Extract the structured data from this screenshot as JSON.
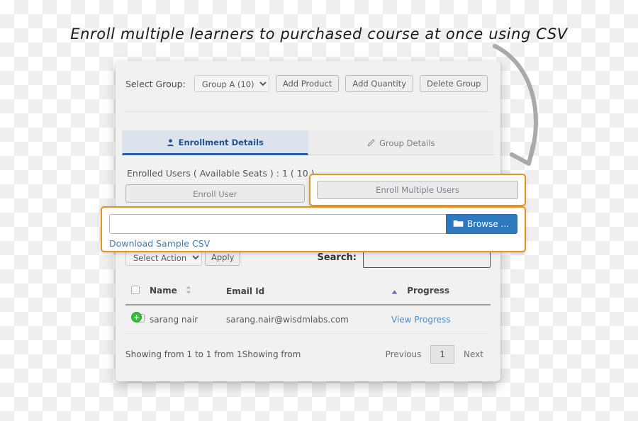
{
  "headline": "Enroll multiple learners to purchased course at once using CSV",
  "toolbar": {
    "select_group_label": "Select Group:",
    "group_selected": "Group A (10)",
    "group_options": [
      "Group A (10)"
    ],
    "add_product_label": "Add Product",
    "add_quantity_label": "Add Quantity",
    "delete_group_label": "Delete Group"
  },
  "tabs": [
    {
      "label": "Enrollment Details",
      "icon": "user-icon",
      "active": true
    },
    {
      "label": "Group Details",
      "icon": "pencil-icon",
      "active": false
    }
  ],
  "content": {
    "seats_text": "Enrolled Users ( Available Seats ) : 1 ( 10 )",
    "enroll_user_label": "Enroll User",
    "enroll_multiple_users_label": "Enroll Multiple Users"
  },
  "upload": {
    "file_value": "",
    "file_placeholder": "",
    "browse_label": "Browse ...",
    "browse_icon": "folder-icon",
    "download_sample_label": "Download Sample CSV"
  },
  "actions": {
    "select_action_value": "Select Action",
    "select_action_options": [
      "Select Action"
    ],
    "apply_label": "Apply",
    "search_label": "Search:",
    "search_value": "",
    "search_placeholder": ""
  },
  "table": {
    "columns": [
      "",
      "Name",
      "Email Id",
      "Progress"
    ],
    "sort_column": "Progress",
    "sort_direction": "asc",
    "rows": [
      {
        "name": "sarang nair",
        "email": "sarang.nair@wisdmlabs.com",
        "progress_link": "View Progress"
      }
    ]
  },
  "footer": {
    "info": "Showing from 1 to 1 from 1Showing from",
    "previous_label": "Previous",
    "page_number": "1",
    "next_label": "Next"
  },
  "colors": {
    "accent_blue": "#2e78bd",
    "highlight_orange": "#e8921f",
    "tab_active_blue": "#23538f",
    "link_blue": "#4b8bd0",
    "plus_green": "#2fc12f"
  }
}
